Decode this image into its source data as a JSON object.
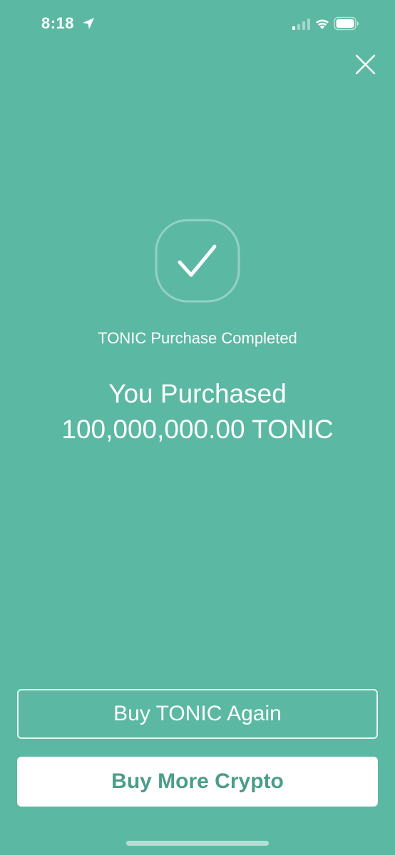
{
  "status_bar": {
    "time": "8:18",
    "icons": [
      "location-arrow-icon",
      "cellular-signal-icon",
      "wifi-icon",
      "battery-icon"
    ]
  },
  "header": {
    "close_icon": "close-icon"
  },
  "confirmation": {
    "icon": "checkmark-icon",
    "subtitle": "TONIC Purchase Completed",
    "headline_line1": "You Purchased",
    "headline_line2": "100,000,000.00 TONIC"
  },
  "actions": {
    "buy_again_label": "Buy TONIC Again",
    "buy_more_label": "Buy More Crypto"
  },
  "colors": {
    "background": "#5bb8a3",
    "accent_text": "#4a9e89",
    "foreground": "#ffffff"
  }
}
